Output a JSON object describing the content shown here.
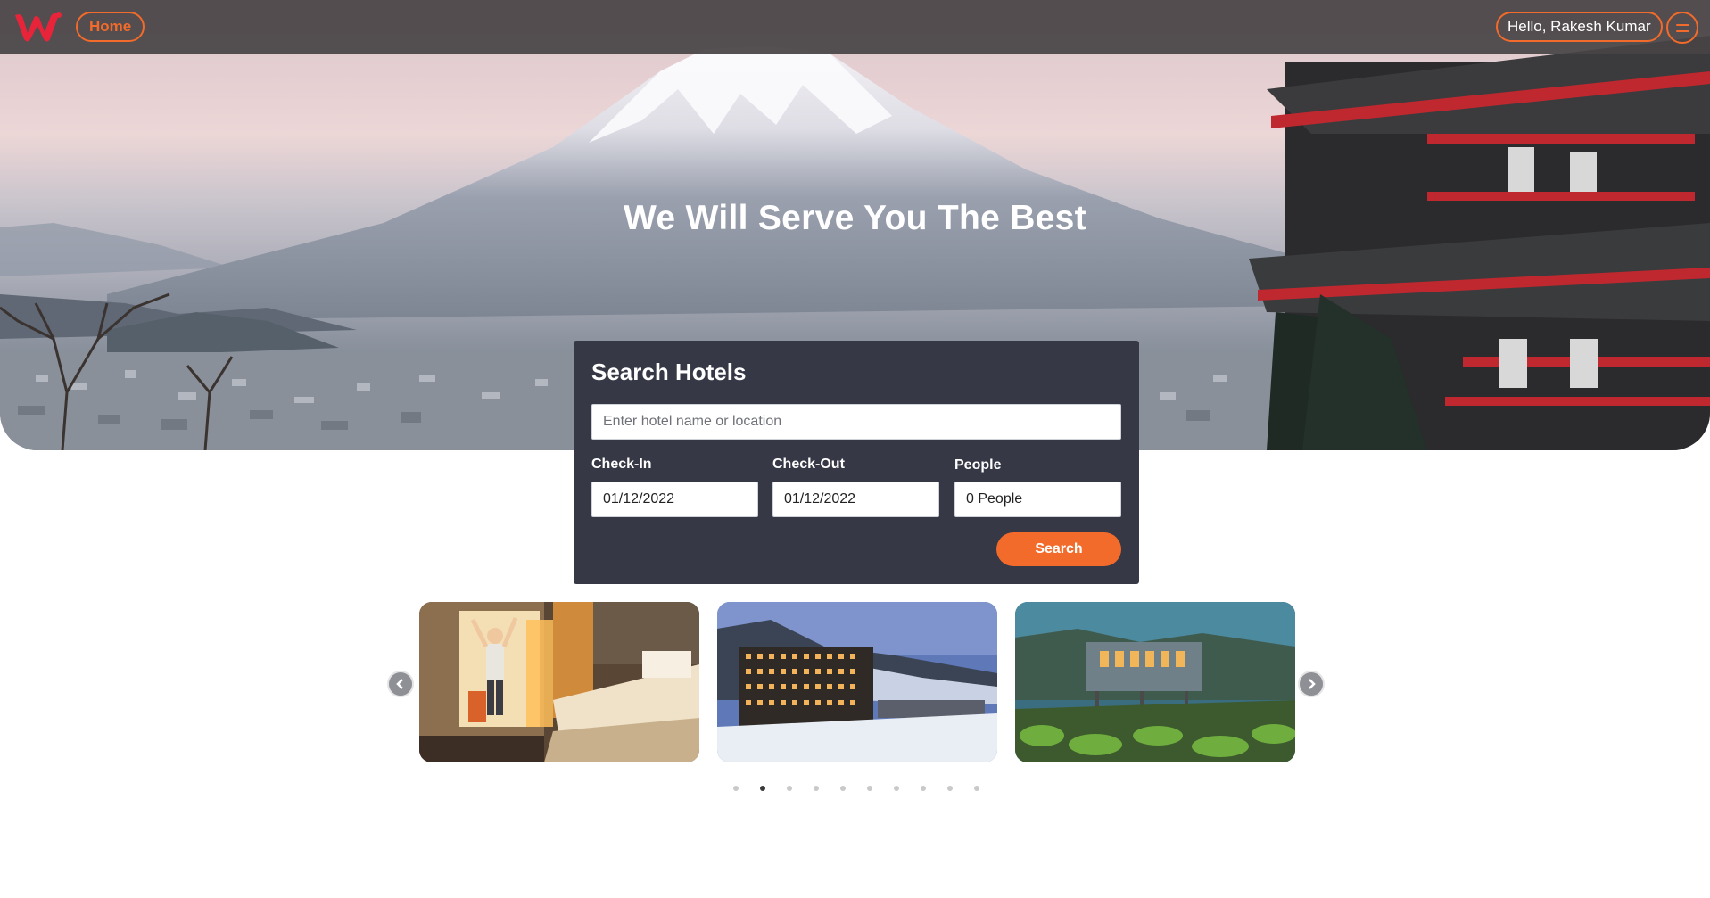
{
  "nav": {
    "home_label": "Home",
    "greeting": "Hello, Rakesh Kumar",
    "menu_icon": "menu-icon"
  },
  "brand": {
    "logo_icon": "w-logo-icon",
    "accent": "#f26b2a",
    "logo_color": "#e8243a"
  },
  "hero": {
    "headline": "We Will Serve You The Best"
  },
  "search": {
    "title": "Search Hotels",
    "query_placeholder": "Enter hotel name or location",
    "checkin_label": "Check-In",
    "checkin_value": "01/12/2022",
    "checkout_label": "Check-Out",
    "checkout_value": "01/12/2022",
    "people_label": "People",
    "people_value": "0 People",
    "submit_label": "Search",
    "panel_color": "#363845"
  },
  "carousel": {
    "slides": [
      {
        "image": "hotel-room-photo"
      },
      {
        "image": "snowy-hotel-photo"
      },
      {
        "image": "modern-lodge-photo"
      }
    ],
    "prev_icon": "chevron-left-icon",
    "next_icon": "chevron-right-icon",
    "dot_count": 10,
    "active_dot": 1
  }
}
